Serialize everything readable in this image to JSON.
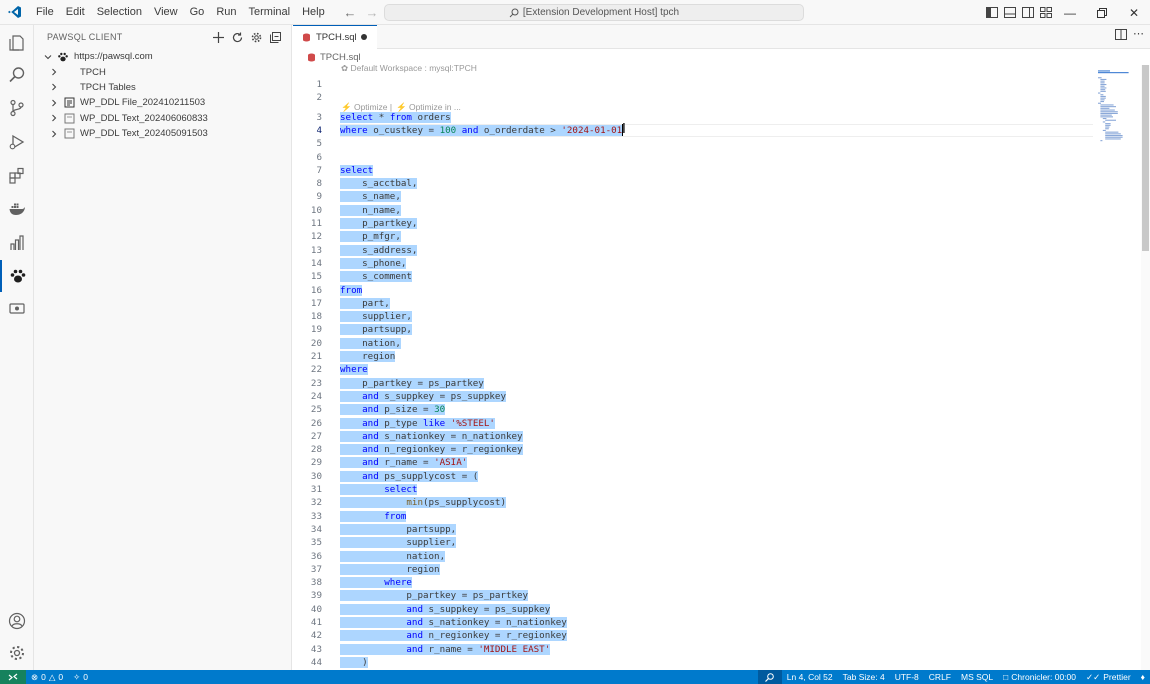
{
  "menu": [
    "File",
    "Edit",
    "Selection",
    "View",
    "Go",
    "Run",
    "Terminal",
    "Help"
  ],
  "command_center": "[Extension Development Host] tpch",
  "sidebar": {
    "title": "PAWSQL CLIENT",
    "root": "https://pawsql.com",
    "items": [
      {
        "label": "TPCH",
        "type": "folder"
      },
      {
        "label": "TPCH Tables",
        "type": "folder"
      },
      {
        "label": "WP_DDL File_202410211503",
        "type": "file"
      },
      {
        "label": "WP_DDL Text_202406060833",
        "type": "text"
      },
      {
        "label": "WP_DDL Text_202405091503",
        "type": "text"
      }
    ]
  },
  "tab": {
    "title": "TPCH.sql"
  },
  "breadcrumb": "TPCH.sql",
  "codelens": {
    "workspace": "Default Workspace : mysql:TPCH",
    "optimize": "Optimize |",
    "optimize_in": "Optimize in ..."
  },
  "code_lines": [
    {
      "n": "1",
      "t": ""
    },
    {
      "n": "2",
      "t": ""
    },
    {
      "n": "3",
      "t": "select * from orders"
    },
    {
      "n": "4",
      "t": "where o_custkey = 100 and o_orderdate > '2024-01-01"
    },
    {
      "n": "5",
      "t": ""
    },
    {
      "n": "6",
      "t": ""
    },
    {
      "n": "7",
      "t": "select"
    },
    {
      "n": "8",
      "t": "    s_acctbal,"
    },
    {
      "n": "9",
      "t": "    s_name,"
    },
    {
      "n": "10",
      "t": "    n_name,"
    },
    {
      "n": "11",
      "t": "    p_partkey,"
    },
    {
      "n": "12",
      "t": "    p_mfgr,"
    },
    {
      "n": "13",
      "t": "    s_address,"
    },
    {
      "n": "14",
      "t": "    s_phone,"
    },
    {
      "n": "15",
      "t": "    s_comment"
    },
    {
      "n": "16",
      "t": "from"
    },
    {
      "n": "17",
      "t": "    part,"
    },
    {
      "n": "18",
      "t": "    supplier,"
    },
    {
      "n": "19",
      "t": "    partsupp,"
    },
    {
      "n": "20",
      "t": "    nation,"
    },
    {
      "n": "21",
      "t": "    region"
    },
    {
      "n": "22",
      "t": "where"
    },
    {
      "n": "23",
      "t": "    p_partkey = ps_partkey"
    },
    {
      "n": "24",
      "t": "    and s_suppkey = ps_suppkey"
    },
    {
      "n": "25",
      "t": "    and p_size = 30"
    },
    {
      "n": "26",
      "t": "    and p_type like '%STEEL'"
    },
    {
      "n": "27",
      "t": "    and s_nationkey = n_nationkey"
    },
    {
      "n": "28",
      "t": "    and n_regionkey = r_regionkey"
    },
    {
      "n": "29",
      "t": "    and r_name = 'ASIA'"
    },
    {
      "n": "30",
      "t": "    and ps_supplycost = ("
    },
    {
      "n": "31",
      "t": "        select"
    },
    {
      "n": "32",
      "t": "            min(ps_supplycost)"
    },
    {
      "n": "33",
      "t": "        from"
    },
    {
      "n": "34",
      "t": "            partsupp,"
    },
    {
      "n": "35",
      "t": "            supplier,"
    },
    {
      "n": "36",
      "t": "            nation,"
    },
    {
      "n": "37",
      "t": "            region"
    },
    {
      "n": "38",
      "t": "        where"
    },
    {
      "n": "39",
      "t": "            p_partkey = ps_partkey"
    },
    {
      "n": "40",
      "t": "            and s_suppkey = ps_suppkey"
    },
    {
      "n": "41",
      "t": "            and s_nationkey = n_nationkey"
    },
    {
      "n": "42",
      "t": "            and n_regionkey = r_regionkey"
    },
    {
      "n": "43",
      "t": "            and r_name = 'MIDDLE EAST'"
    },
    {
      "n": "44",
      "t": "    )"
    }
  ],
  "status": {
    "errors": "0",
    "warnings": "0",
    "ports": "0",
    "position": "Ln 4, Col 52",
    "tab_size": "Tab Size: 4",
    "encoding": "UTF-8",
    "eol": "CRLF",
    "language": "MS SQL",
    "chronicler": "Chronicler: 00:00",
    "prettier": "Prettier"
  },
  "colors": {
    "accent": "#007acc",
    "selection": "#add6ff",
    "keyword": "#0000ff",
    "string": "#a31515",
    "number": "#098658"
  }
}
